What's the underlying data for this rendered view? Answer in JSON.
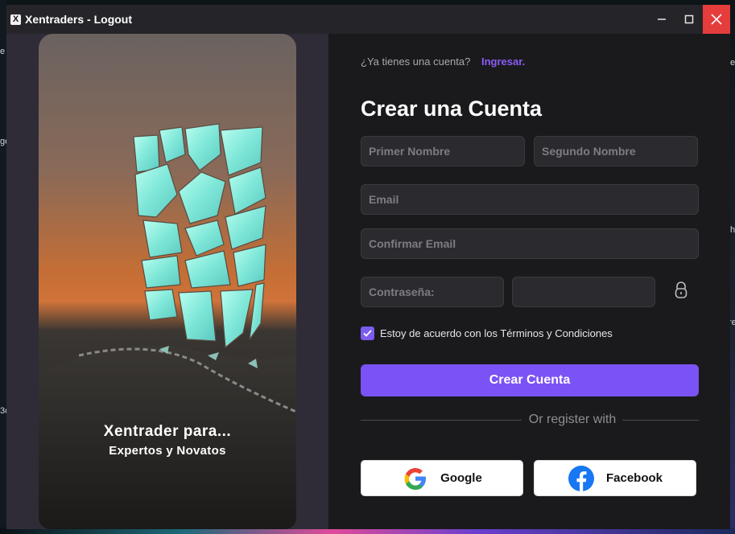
{
  "window": {
    "title": "Xentraders - Logout"
  },
  "hero": {
    "title": "Xentrader para...",
    "subtitle": "Expertos y Novatos"
  },
  "form": {
    "login_prompt": "¿Ya tienes una cuenta?",
    "login_link": "Ingresar.",
    "heading": "Crear una Cuenta",
    "first_name_placeholder": "Primer Nombre",
    "second_name_placeholder": "Segundo Nombre",
    "email_placeholder": "Email",
    "confirm_email_placeholder": "Confirmar Email",
    "password_placeholder": "Contraseña:",
    "password_confirm_placeholder": "",
    "terms_label": "Estoy de acuerdo con los Términos y Condiciones",
    "terms_checked": true,
    "submit_label": "Crear Cuenta",
    "or_text": "Or register with",
    "google_label": "Google",
    "facebook_label": "Facebook"
  },
  "desktop": {
    "edge_left": [
      "e",
      "ge",
      "3c"
    ],
    "edge_right": [
      "e",
      "h",
      "re"
    ]
  },
  "colors": {
    "accent": "#7b52f5",
    "link": "#8a5cf6",
    "background": "#1a1a1d",
    "close_button": "#e53c3c"
  },
  "icons": [
    "app-logo-icon",
    "minimize-icon",
    "maximize-icon",
    "close-icon",
    "lock-icon",
    "check-icon",
    "google-icon",
    "facebook-icon"
  ]
}
